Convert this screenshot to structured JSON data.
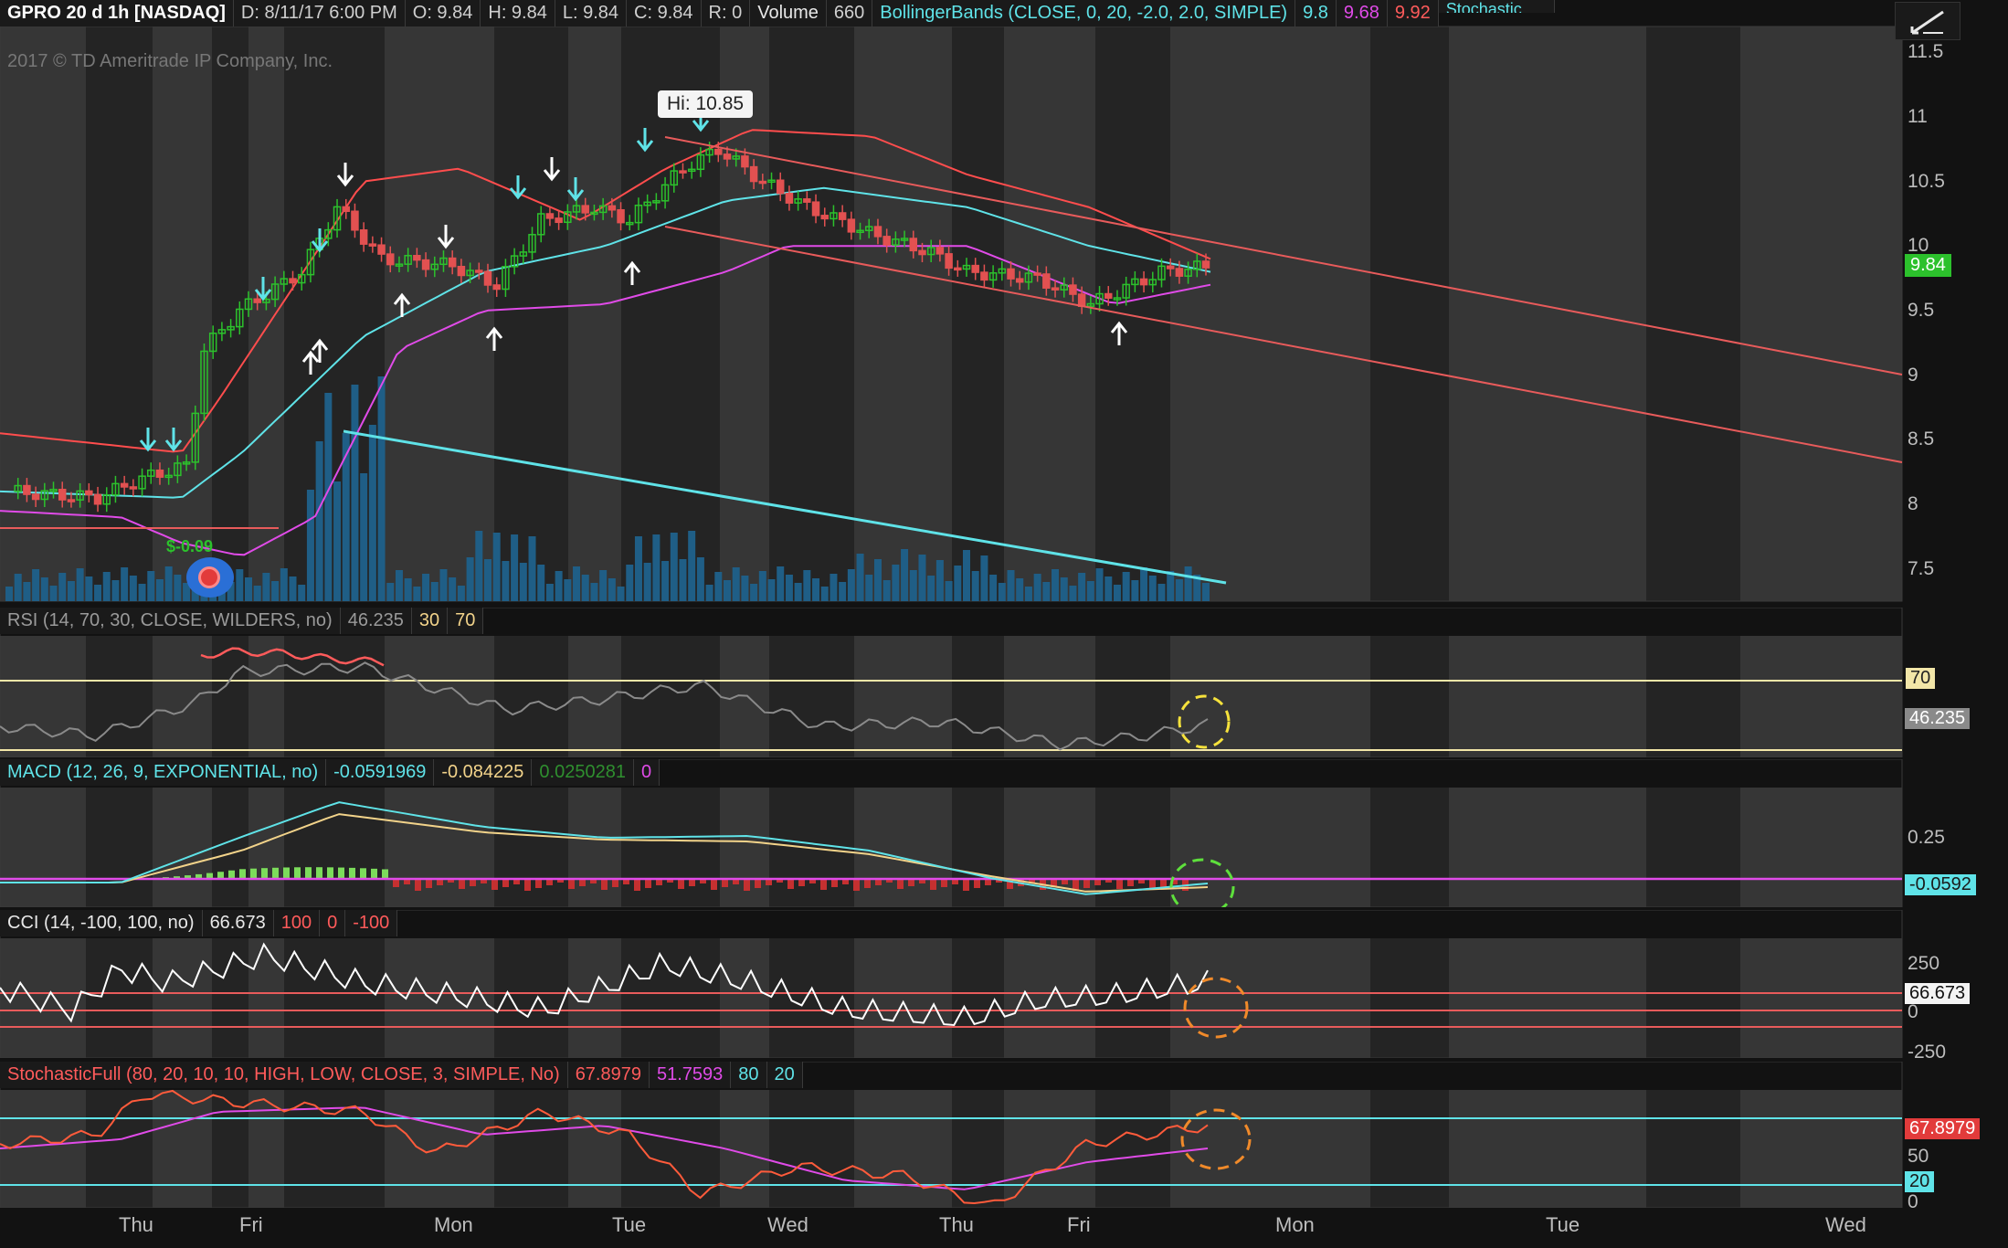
{
  "main_header": {
    "symbol": "GPRO 20 d 1h [NASDAQ]",
    "date": "D:  8/11/17 6:00 PM",
    "open": "O:  9.84",
    "high": "H:  9.84",
    "low": "L:  9.84",
    "close": "C:  9.84",
    "range": "R:  0",
    "volume_label": "Volume",
    "volume_value": "660",
    "bb_label": "BollingerBands (CLOSE, 0, 20, -2.0, 2.0, SIMPLE)",
    "bb_mid": "9.8",
    "bb_low": "9.68",
    "bb_up": "9.92",
    "next_study": "Stochastic",
    "copyright": "2017 © TD Ameritrade IP Company, Inc.",
    "hi_callout": "Hi: 10.85",
    "earnings_label": "$-0.09",
    "price_tag": "9.84"
  },
  "main_axis": [
    "11.5",
    "11",
    "10.5",
    "10",
    "9.5",
    "9",
    "8.5",
    "8",
    "7.5"
  ],
  "rsi": {
    "label": "RSI (14, 70, 30, CLOSE, WILDERS, no)",
    "value": "46.235",
    "low": "30",
    "high": "70",
    "tag_high": "70",
    "tag_value": "46.235"
  },
  "macd": {
    "label": "MACD (12, 26, 9, EXPONENTIAL, no)",
    "value": "-0.0591969",
    "avg": "-0.084225",
    "diff": "0.0250281",
    "zero": "0",
    "axis": "0.25",
    "tag_value": "-0.0592"
  },
  "cci": {
    "label": "CCI (14, -100, 100, no)",
    "value": "66.673",
    "upper": "100",
    "zero": "0",
    "lower": "-100",
    "axis_top": "250",
    "axis_zero": "0",
    "axis_bottom": "-250",
    "tag_value": "66.673"
  },
  "stoch": {
    "label": "StochasticFull (80, 20, 10, 10, HIGH, LOW, CLOSE, 3, SIMPLE, No)",
    "k": "67.8979",
    "d": "51.7593",
    "over_bought": "80",
    "over_sold": "20",
    "axis_mid": "50",
    "axis_zero": "0",
    "tag_value": "67.8979",
    "tag_low": "20"
  },
  "time_axis": [
    "Thu",
    "Fri",
    "Mon",
    "Tue",
    "Wed",
    "Thu",
    "Fri",
    "Mon",
    "Tue",
    "Wed"
  ],
  "colors": {
    "bg": "#121212",
    "session": "#2b2b2b",
    "up": "#2cc12c",
    "down": "#e25151",
    "bb_upper": "#ff4d4d",
    "bb_mid": "#5fe3e8",
    "bb_lower": "#e04be8",
    "volume": "#1f5e86",
    "rsi": "#7a7a7a",
    "rsi_over": "#ff5b5b",
    "macd_line": "#5fe3e8",
    "macd_avg": "#f2d38a",
    "cci": "#ffffff",
    "stoch_k": "#ff5b3b",
    "stoch_d": "#e04be8",
    "guide": "#5fe3e8",
    "red_line": "#e85b5b"
  }
}
